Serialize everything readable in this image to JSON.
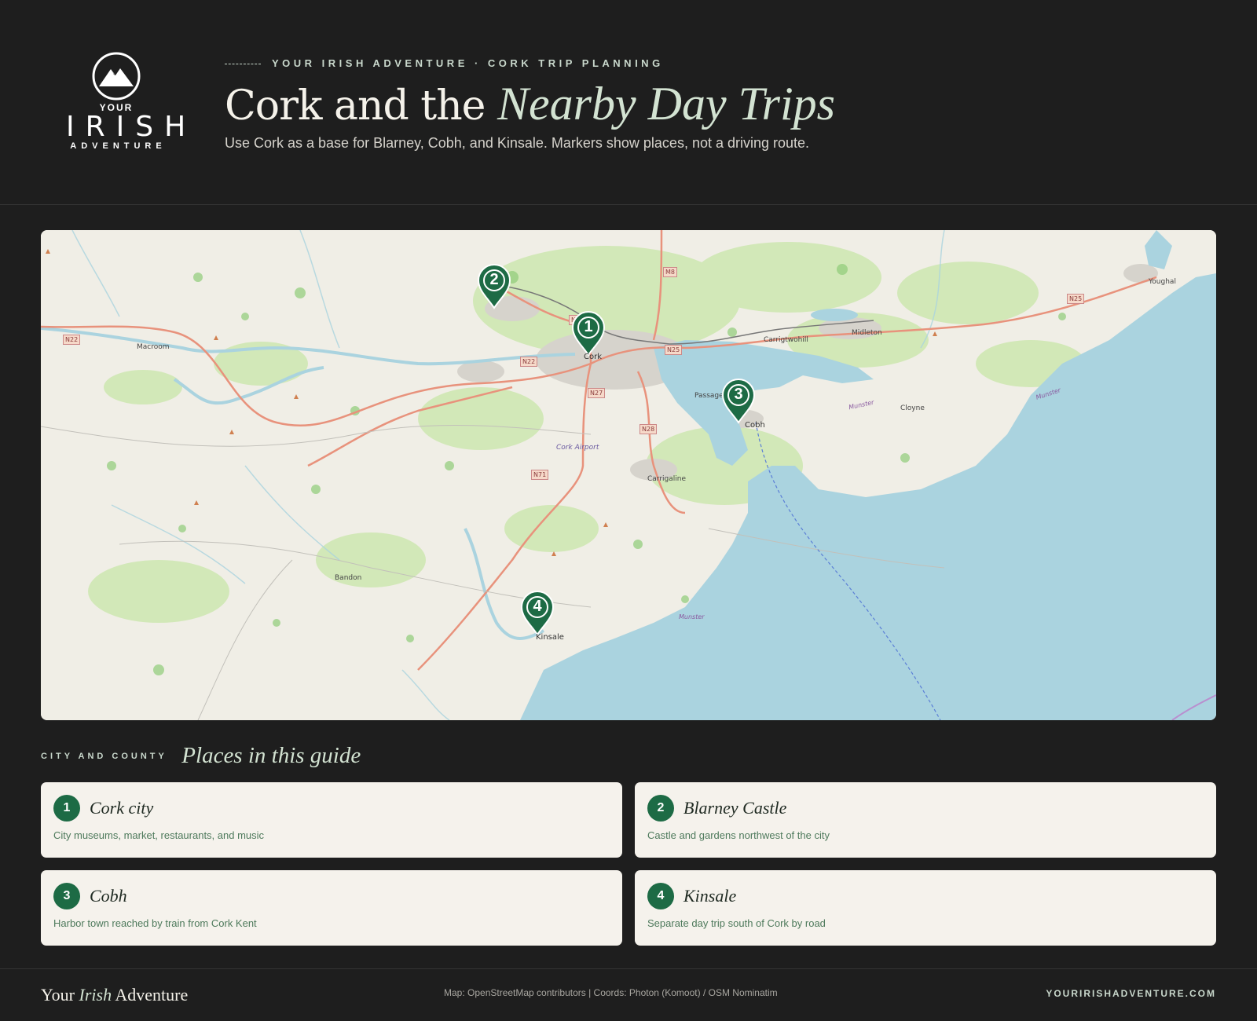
{
  "header": {
    "logo": {
      "your": "YOUR",
      "irish": "IRISH",
      "adventure": "ADVENTURE"
    },
    "eyebrow": "YOUR IRISH ADVENTURE · CORK TRIP PLANNING",
    "title_plain": "Cork and the ",
    "title_italic": "Nearby Day Trips",
    "subtitle": "Use Cork as a base for Blarney, Cobh, and Kinsale. Markers show places, not a driving route."
  },
  "map": {
    "markers": [
      {
        "number": "1",
        "label": "Cork"
      },
      {
        "number": "2",
        "label": ""
      },
      {
        "number": "3",
        "label": "Cobh"
      },
      {
        "number": "4",
        "label": "Kinsale"
      }
    ],
    "towns": [
      "Macroom",
      "Youghal",
      "Midleton",
      "Carrigtwohill",
      "Passage West",
      "Cloyne",
      "Carrigaline",
      "Bandon",
      "Cork Airport"
    ],
    "roads": [
      "N22",
      "N20",
      "M8",
      "N25",
      "N22",
      "N27",
      "N28",
      "N71",
      "N22",
      "N25"
    ],
    "sea_labels": [
      "Munster",
      "Munster",
      "Munster"
    ],
    "colors": {
      "land": "#f0eee6",
      "sea": "#aad3df",
      "green": "#c8e6a8",
      "road": "#e8927c",
      "urban": "#d9d6d0",
      "marker": "#1d6b45"
    }
  },
  "places": {
    "eyebrow": "CITY AND COUNTY",
    "title": "Places in this guide",
    "items": [
      {
        "number": "1",
        "name": "Cork city",
        "desc": "City museums, market, restaurants, and music"
      },
      {
        "number": "2",
        "name": "Blarney Castle",
        "desc": "Castle and gardens northwest of the city"
      },
      {
        "number": "3",
        "name": "Cobh",
        "desc": "Harbor town reached by train from Cork Kent"
      },
      {
        "number": "4",
        "name": "Kinsale",
        "desc": "Separate day trip south of Cork by road"
      }
    ]
  },
  "footer": {
    "brand_1": "Your ",
    "brand_italic": "Irish",
    "brand_2": " Adventure",
    "credits": "Map: OpenStreetMap contributors | Coords: Photon (Komoot) / OSM Nominatim",
    "site": "YOURIRISHADVENTURE.COM"
  }
}
